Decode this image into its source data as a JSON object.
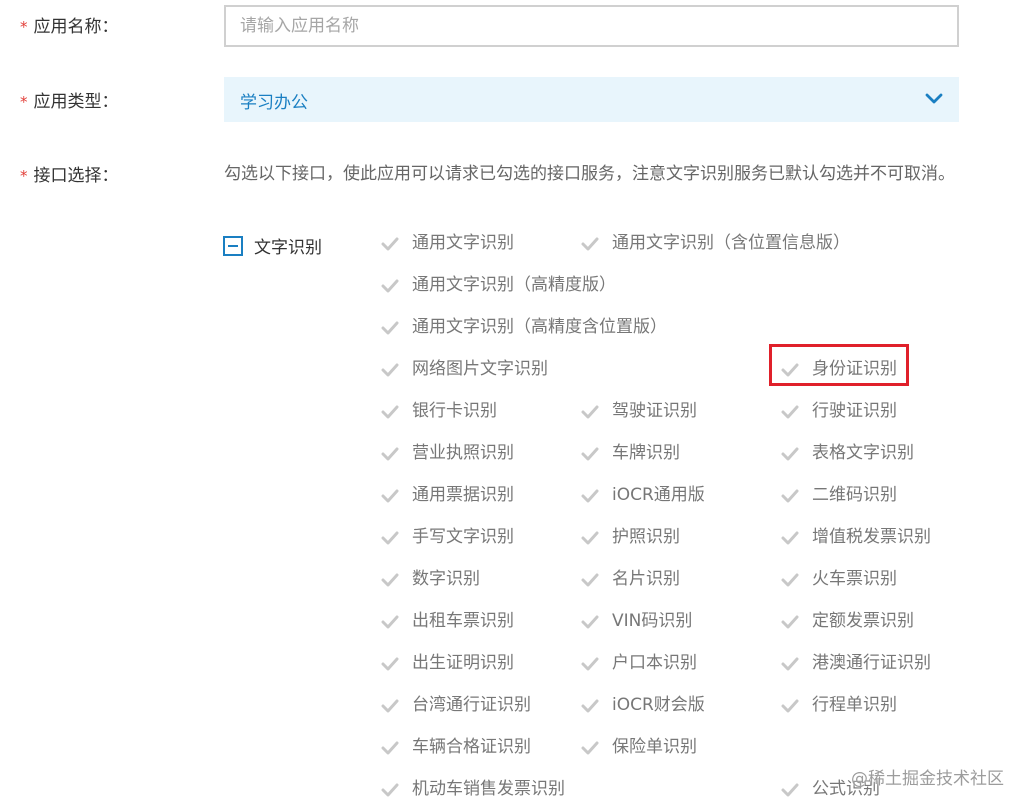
{
  "form": {
    "required_mark": "*",
    "app_name_label": "应用名称：",
    "app_name_placeholder": "请输入应用名称",
    "app_name_value": "",
    "app_type_label": "应用类型：",
    "app_type_value": "学习办公",
    "api_select_label": "接口选择：",
    "api_select_desc": "勾选以下接口，使此应用可以请求已勾选的接口服务，注意文字识别服务已默认勾选并不可取消。"
  },
  "group": {
    "label": "文字识别",
    "toggle_state": "partial"
  },
  "options": [
    {
      "label": "通用文字识别",
      "checked": true
    },
    {
      "label": "通用文字识别（含位置信息版）",
      "checked": true
    },
    {
      "label": "通用文字识别（高精度版）",
      "checked": true
    },
    {
      "label": "通用文字识别（高精度含位置版）",
      "checked": true
    },
    {
      "label": "网络图片文字识别",
      "checked": true
    },
    {
      "label": "身份证识别",
      "checked": true,
      "highlighted": true
    },
    {
      "label": "银行卡识别",
      "checked": true
    },
    {
      "label": "驾驶证识别",
      "checked": true
    },
    {
      "label": "行驶证识别",
      "checked": true
    },
    {
      "label": "营业执照识别",
      "checked": true
    },
    {
      "label": "车牌识别",
      "checked": true
    },
    {
      "label": "表格文字识别",
      "checked": true
    },
    {
      "label": "通用票据识别",
      "checked": true
    },
    {
      "label": "iOCR通用版",
      "checked": true
    },
    {
      "label": "二维码识别",
      "checked": true
    },
    {
      "label": "手写文字识别",
      "checked": true
    },
    {
      "label": "护照识别",
      "checked": true
    },
    {
      "label": "增值税发票识别",
      "checked": true
    },
    {
      "label": "数字识别",
      "checked": true
    },
    {
      "label": "名片识别",
      "checked": true
    },
    {
      "label": "火车票识别",
      "checked": true
    },
    {
      "label": "出租车票识别",
      "checked": true
    },
    {
      "label": "VIN码识别",
      "checked": true
    },
    {
      "label": "定额发票识别",
      "checked": true
    },
    {
      "label": "出生证明识别",
      "checked": true
    },
    {
      "label": "户口本识别",
      "checked": true
    },
    {
      "label": "港澳通行证识别",
      "checked": true
    },
    {
      "label": "台湾通行证识别",
      "checked": true
    },
    {
      "label": "iOCR财会版",
      "checked": true
    },
    {
      "label": "行程单识别",
      "checked": true
    },
    {
      "label": "车辆合格证识别",
      "checked": true
    },
    {
      "label": "保险单识别",
      "checked": true
    },
    {
      "label": "机动车销售发票识别",
      "checked": true
    },
    {
      "label": "公式识别",
      "checked": true
    }
  ],
  "colors": {
    "accent": "#1a7fc2",
    "select_bg": "#e8f5fc",
    "required": "#e2403a",
    "highlight_border": "#e0202a",
    "disabled_check": "#c8c8c8"
  },
  "watermark": "@稀土掘金技术社区"
}
